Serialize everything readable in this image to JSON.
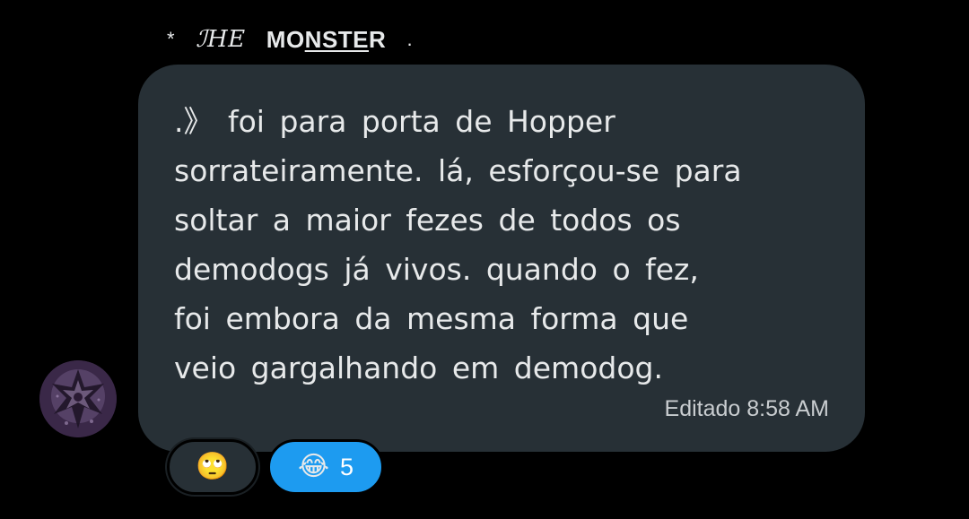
{
  "sender": {
    "prefix": "*",
    "name_part1": "ℐHE",
    "name_part2": "MO",
    "name_part3": "NSTE",
    "name_part4": "R",
    "suffix": "."
  },
  "message": {
    "text": ".》 foi para porta de Hopper\nsorrateiramente. lá, esforçou-se para\nsoltar a maior fezes de todos os\ndemodogs já vivos. quando o fez,\nfoi embora da mesma forma que\nveio gargalhando em demodog.",
    "meta": "Editado 8:58 AM"
  },
  "reactions": [
    {
      "emoji": "🙄",
      "icon": "eye-roll-emoji-icon",
      "count": "",
      "selected": false
    },
    {
      "emoji": "😂",
      "icon": "tears-of-joy-emoji-icon",
      "count": "5",
      "selected": true
    }
  ],
  "colors": {
    "background": "#000000",
    "bubble": "#273036",
    "text": "#e7e9ea",
    "accent": "#1d9bf0"
  }
}
